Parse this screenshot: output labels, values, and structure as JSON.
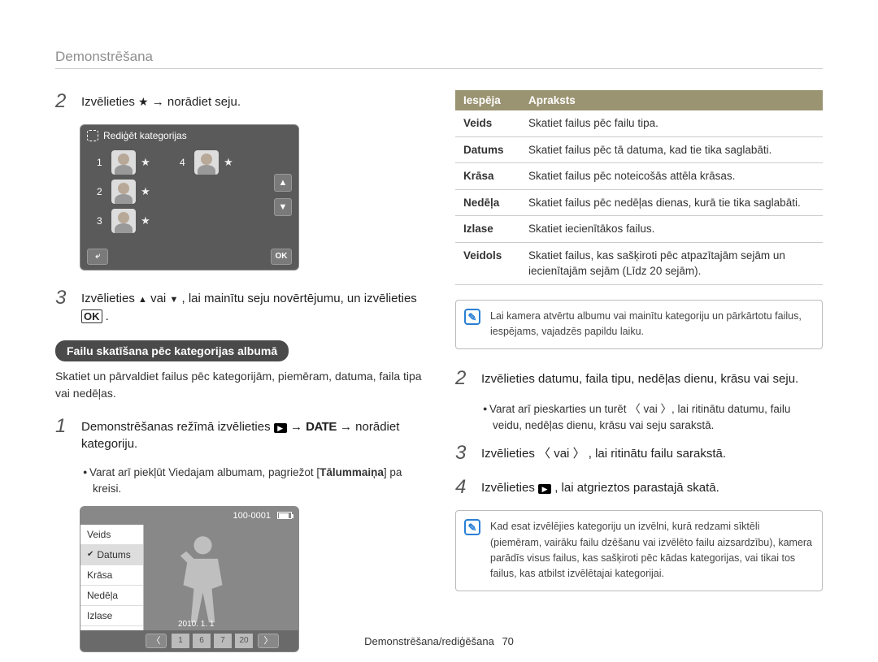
{
  "header": "Demonstrēšana",
  "left": {
    "step2": {
      "num": "2",
      "text_a": "Izvēlieties ",
      "text_b": " → norādiet seju."
    },
    "shot1": {
      "title": "Rediģēt kategorijas",
      "rows": [
        "1",
        "2",
        "3",
        "4"
      ],
      "btn_back": "⤶",
      "btn_ok": "OK"
    },
    "step3": {
      "num": "3",
      "text_a": "Izvēlieties ",
      "text_b": " vai ",
      "text_c": " , lai mainītu seju novērtējumu, un izvēlieties ",
      "text_d": "."
    },
    "pill": "Failu skatīšana pēc kategorijas albumā",
    "para": "Skatiet un pārvaldiet failus pēc kategorijām, piemēram, datuma, faila tipa vai nedēļas.",
    "step1b": {
      "num": "1",
      "text_a": "Demonstrēšanas režīmā izvēlieties ",
      "text_b": " → ",
      "text_c": " → norādiet kategoriju."
    },
    "bullet1": {
      "a": "Varat arī piekļūt Viedajam albumam, pagriežot [",
      "b": "Tālummaiņa",
      "c": "] pa kreisi."
    },
    "shot2": {
      "topcode": "100-0001",
      "menu": [
        "Veids",
        "Datums",
        "Krāsa",
        "Nedēļa",
        "Izlase",
        "Veidols"
      ],
      "menu_selected_index": 1,
      "thumbs": [
        "1",
        "6",
        "7",
        "20"
      ],
      "date": "2010. 1. 1"
    }
  },
  "right": {
    "table": {
      "h1": "Iespēja",
      "h2": "Apraksts",
      "rows": [
        {
          "k": "Veids",
          "v": "Skatiet failus pēc failu tipa."
        },
        {
          "k": "Datums",
          "v": "Skatiet failus pēc tā datuma, kad tie tika saglabāti."
        },
        {
          "k": "Krāsa",
          "v": "Skatiet failus pēc noteicošās attēla krāsas."
        },
        {
          "k": "Nedēļa",
          "v": "Skatiet failus pēc nedēļas dienas, kurā tie tika saglabāti."
        },
        {
          "k": "Izlase",
          "v": "Skatiet iecienītākos failus."
        },
        {
          "k": "Veidols",
          "v": "Skatiet failus, kas sašķiroti pēc atpazītajām sejām un iecienītajām sejām (Līdz 20 sejām)."
        }
      ]
    },
    "note1": "Lai kamera atvērtu albumu vai mainītu kategoriju un pārkārtotu failus, iespējams, vajadzēs papildu laiku.",
    "step2": {
      "num": "2",
      "text": "Izvēlieties datumu, faila tipu, nedēļas dienu, krāsu vai seju."
    },
    "bullet2": {
      "a": "Varat arī pieskarties un turēt ",
      "b": " vai ",
      "c": ", lai ritinātu datumu, failu veidu, nedēļas dienu, krāsu vai seju sarakstā."
    },
    "step3": {
      "num": "3",
      "text_a": "Izvēlieties ",
      "text_b": " vai ",
      "text_c": " , lai ritinātu failu sarakstā."
    },
    "step4": {
      "num": "4",
      "text_a": "Izvēlieties ",
      "text_b": " , lai atgrieztos parastajā skatā."
    },
    "note2": "Kad esat izvēlējies kategoriju un izvēlni, kurā redzami sīktēli (piemēram, vairāku failu dzēšanu vai izvēlēto failu aizsardzību), kamera parādīs visus failus, kas sašķiroti pēc kādas kategorijas, vai tikai tos failus, kas atbilst izvēlētajai kategorijai."
  },
  "footer": {
    "text": "Demonstrēšana/rediģēšana",
    "page": "70"
  }
}
